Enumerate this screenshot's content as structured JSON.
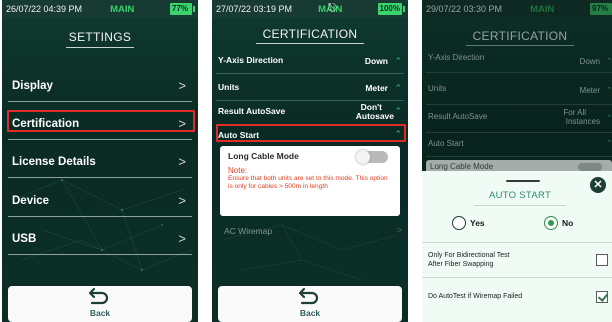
{
  "colors": {
    "accent_green": "#38d16a",
    "highlight_red": "#e02b2b",
    "note_red": "#e0401e",
    "sheet_title": "#2f8a6c"
  },
  "screen1": {
    "time": "26/07/22 04:39 PM",
    "mode": "MAIN",
    "battery": "77%",
    "title": "SETTINGS",
    "menu": [
      {
        "label": "Display",
        "icon": "chevron-right-icon"
      },
      {
        "label": "Certification",
        "icon": "chevron-right-icon"
      },
      {
        "label": "License Details",
        "icon": "chevron-right-icon"
      },
      {
        "label": "Device",
        "icon": "chevron-right-icon"
      },
      {
        "label": "USB",
        "icon": "chevron-right-icon"
      }
    ],
    "highlighted_item": "Certification",
    "back_label": "Back"
  },
  "screen2": {
    "time": "27/07/22 03:19 PM",
    "mode": "MAIN",
    "battery": "100%",
    "title": "CERTIFICATION",
    "rows": [
      {
        "label": "Y-Axis Direction",
        "value": "Down"
      },
      {
        "label": "Units",
        "value": "Meter"
      },
      {
        "label": "Result AutoSave",
        "value_line1": "Don't",
        "value_line2": "Autosave"
      },
      {
        "label": "Auto Start",
        "value": ""
      }
    ],
    "card": {
      "title": "Long Cable Mode",
      "toggle_on": false,
      "note_title": "Note:",
      "note_body": "Ensure that both units are set to this mode. This option is only for cables > 500m in length"
    },
    "below_card": "AC Wiremap",
    "back_label": "Back"
  },
  "screen3": {
    "time": "29/07/22 03:30 PM",
    "mode": "MAIN",
    "battery": "97%",
    "title": "CERTIFICATION",
    "rows": [
      {
        "label": "Y-Axis Direction",
        "value": "Down"
      },
      {
        "label": "Units",
        "value": "Meter"
      },
      {
        "label": "Result AutoSave",
        "value_line1": "For All",
        "value_line2": "Instances"
      },
      {
        "label": "Auto Start",
        "value": ""
      },
      {
        "label": "Long Cable Mode",
        "value": ""
      }
    ],
    "sheet": {
      "title": "AUTO START",
      "yes_label": "Yes",
      "no_label": "No",
      "selected": "No",
      "options": [
        {
          "line1": "Only For Bidirectional Test",
          "line2": "After Fiber Swapping",
          "checked": false
        },
        {
          "line1": "Do AutoTest if Wiremap Failed",
          "line2": "",
          "checked": true
        }
      ]
    }
  }
}
